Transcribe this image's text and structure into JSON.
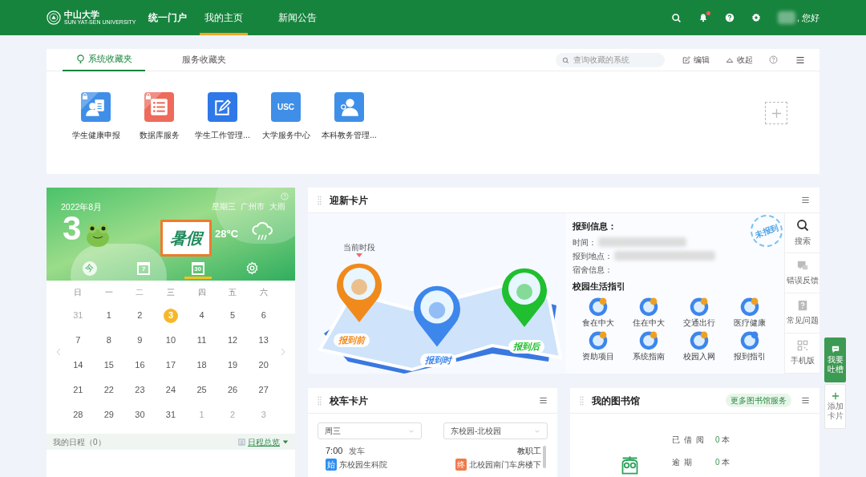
{
  "header": {
    "logo_text": "中山大学",
    "logo_subtext": "SUN YAT-SEN UNIVERSITY",
    "portal": "统一门户",
    "nav": [
      {
        "label": "我的主页",
        "selected": true
      },
      {
        "label": "新闻公告",
        "selected": false
      }
    ],
    "notification_dot": true,
    "greeting": ", 您好"
  },
  "favorites": {
    "tabs": [
      {
        "label": "系统收藏夹",
        "selected": true
      },
      {
        "label": "服务收藏夹",
        "selected": false
      }
    ],
    "search": {
      "placeholder": "查询收藏的系统"
    },
    "actions": [
      {
        "kind": "edit",
        "label": "编辑"
      },
      {
        "kind": "collapse",
        "label": "收起"
      }
    ],
    "apps": [
      {
        "label": "学生健康申报",
        "kind": "person-doc",
        "color": "#3f8fe8",
        "locked": true
      },
      {
        "label": "数据库服务",
        "kind": "list",
        "color": "#ee6a5a",
        "locked": true
      },
      {
        "label": "学生工作管理...",
        "kind": "pen",
        "color": "#2f78e8",
        "locked": false
      },
      {
        "label": "大学服务中心",
        "kind": "text",
        "text": "USC",
        "color": "#3f8fe8",
        "locked": false
      },
      {
        "label": "本科教务管理...",
        "kind": "teacher",
        "color": "#3f8fe8",
        "locked": false
      }
    ]
  },
  "calendar": {
    "month": "2022年8月",
    "day": "3",
    "weekday": "星期三",
    "city": "广州市",
    "weather": "大雨",
    "temperature": "28°C",
    "holiday": "暑假",
    "views": [
      {
        "kind": "today",
        "label": "今",
        "selected": false
      },
      {
        "kind": "week",
        "label": "7",
        "selected": false
      },
      {
        "kind": "month",
        "label": "30",
        "selected": true
      },
      {
        "kind": "settings",
        "selected": false
      }
    ],
    "weekdays": [
      "日",
      "一",
      "二",
      "三",
      "四",
      "五",
      "六"
    ],
    "days": [
      {
        "label": "31",
        "outside": true,
        "selected": false
      },
      {
        "label": "1",
        "outside": false,
        "selected": false
      },
      {
        "label": "2",
        "outside": false,
        "selected": false
      },
      {
        "label": "3",
        "outside": false,
        "selected": true
      },
      {
        "label": "4",
        "outside": false,
        "selected": false
      },
      {
        "label": "5",
        "outside": false,
        "selected": false
      },
      {
        "label": "6",
        "outside": false,
        "selected": false
      },
      {
        "label": "7",
        "outside": false,
        "selected": false
      },
      {
        "label": "8",
        "outside": false,
        "selected": false
      },
      {
        "label": "9",
        "outside": false,
        "selected": false
      },
      {
        "label": "10",
        "outside": false,
        "selected": false
      },
      {
        "label": "11",
        "outside": false,
        "selected": false
      },
      {
        "label": "12",
        "outside": false,
        "selected": false
      },
      {
        "label": "13",
        "outside": false,
        "selected": false
      },
      {
        "label": "14",
        "outside": false,
        "selected": false
      },
      {
        "label": "15",
        "outside": false,
        "selected": false
      },
      {
        "label": "16",
        "outside": false,
        "selected": false
      },
      {
        "label": "17",
        "outside": false,
        "selected": false
      },
      {
        "label": "18",
        "outside": false,
        "selected": false
      },
      {
        "label": "19",
        "outside": false,
        "selected": false
      },
      {
        "label": "20",
        "outside": false,
        "selected": false
      },
      {
        "label": "21",
        "outside": false,
        "selected": false
      },
      {
        "label": "22",
        "outside": false,
        "selected": false
      },
      {
        "label": "23",
        "outside": false,
        "selected": false
      },
      {
        "label": "24",
        "outside": false,
        "selected": false
      },
      {
        "label": "25",
        "outside": false,
        "selected": false
      },
      {
        "label": "26",
        "outside": false,
        "selected": false
      },
      {
        "label": "27",
        "outside": false,
        "selected": false
      },
      {
        "label": "28",
        "outside": false,
        "selected": false
      },
      {
        "label": "29",
        "outside": false,
        "selected": false
      },
      {
        "label": "30",
        "outside": false,
        "selected": false
      },
      {
        "label": "31",
        "outside": false,
        "selected": false
      },
      {
        "label": "1",
        "outside": true,
        "selected": false
      },
      {
        "label": "2",
        "outside": true,
        "selected": false
      },
      {
        "label": "3",
        "outside": true,
        "selected": false
      }
    ],
    "schedule_title": "我的日程（0）",
    "schedule_link": "日程总览"
  },
  "welcome": {
    "title": "迎新卡片",
    "current_label": "当前时段",
    "stages": [
      {
        "label": "报到前",
        "color": "#f08a1c",
        "selected": true
      },
      {
        "label": "报到时",
        "color": "#3d86ec",
        "selected": false
      },
      {
        "label": "报到后",
        "color": "#1fbf2f",
        "selected": false
      }
    ],
    "info_title": "报到信息：",
    "info_fields": [
      "时间：",
      "报到地点：",
      "宿舍信息："
    ],
    "stamp": "未报到",
    "guide_title": "校园生活指引",
    "guide": [
      {
        "label": "食在中大",
        "kind": "food"
      },
      {
        "label": "住在中大",
        "kind": "home"
      },
      {
        "label": "交通出行",
        "kind": "bus"
      },
      {
        "label": "医疗健康",
        "kind": "medical"
      },
      {
        "label": "资助项目",
        "kind": "money"
      },
      {
        "label": "系统指南",
        "kind": "screen"
      },
      {
        "label": "校园入网",
        "kind": "wifi"
      },
      {
        "label": "报到指引",
        "kind": "smile"
      }
    ],
    "tools": [
      {
        "kind": "search",
        "label": "搜索"
      },
      {
        "kind": "feedback",
        "label": "错误反馈"
      },
      {
        "kind": "question",
        "label": "常见问题"
      },
      {
        "kind": "qr",
        "label": "手机版"
      }
    ]
  },
  "bus": {
    "title": "校车卡片",
    "day_select": "周三",
    "route_select": "东校园-北校园",
    "trips": [
      {
        "time": "7:00",
        "status": "发车",
        "type": "教职工",
        "start_tag": "始",
        "start": "东校园生科院",
        "end_tag": "终",
        "end": "北校园南门车房楼下"
      }
    ]
  },
  "library": {
    "title": "我的图书馆",
    "more": "更多图书馆服务",
    "stats": [
      {
        "label": "已借阅",
        "value": "0",
        "unit": "本"
      },
      {
        "label": "逾期",
        "value": "0",
        "unit": "本"
      }
    ]
  },
  "floating": [
    {
      "kind": "chat",
      "label": "我要吐槽"
    },
    {
      "kind": "add",
      "label": "添加卡片"
    }
  ]
}
